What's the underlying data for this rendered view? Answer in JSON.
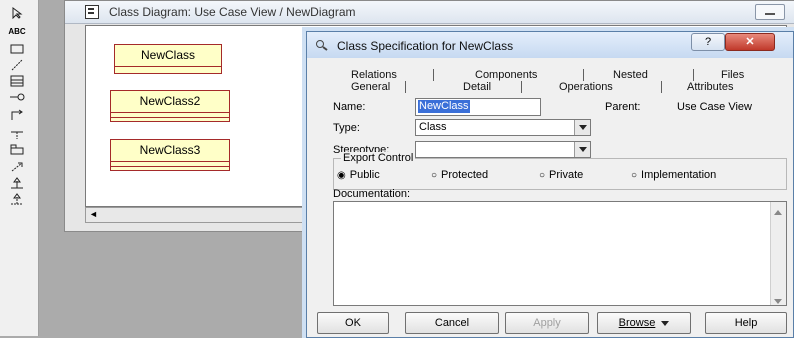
{
  "toolbox": {
    "text_tool_label": "ABC",
    "tools": [
      "select-arrow-icon",
      "text-tool-icon",
      "note-icon",
      "anchor-note-icon",
      "class-icon",
      "interface-icon",
      "unidirectional-association-icon",
      "association-class-icon",
      "package-icon",
      "dependency-icon",
      "generalization-icon",
      "realize-icon"
    ]
  },
  "diagram_window": {
    "title": "Class Diagram: Use Case View / NewDiagram",
    "classes": [
      "NewClass",
      "NewClass2",
      "NewClass3"
    ],
    "scroll_left_arrow": "◄"
  },
  "dialog": {
    "title": "Class Specification for NewClass",
    "help_glyph": "?",
    "close_glyph": "✕",
    "tabs_back_row": [
      "Relations",
      "Components",
      "Nested",
      "Files"
    ],
    "tabs_front_row": [
      "General",
      "Detail",
      "Operations",
      "Attributes"
    ],
    "name_label": "Name:",
    "name_value": "NewClass",
    "parent_label": "Parent:",
    "parent_value": "Use Case View",
    "type_label": "Type:",
    "type_value": "Class",
    "stereotype_label": "Stereotype:",
    "stereotype_value": "",
    "export_control_label": "Export Control",
    "export_options": [
      "Public",
      "Protected",
      "Private",
      "Implementation"
    ],
    "selected_export": "Public",
    "documentation_label": "Documentation:",
    "documentation_value": "",
    "buttons": {
      "ok": "OK",
      "cancel": "Cancel",
      "apply": "Apply",
      "browse": "Browse",
      "help": "Help"
    }
  },
  "colors": {
    "class_fill": "#ffffc8",
    "class_border": "#a52a2a",
    "selection": "#3a6fd8"
  }
}
